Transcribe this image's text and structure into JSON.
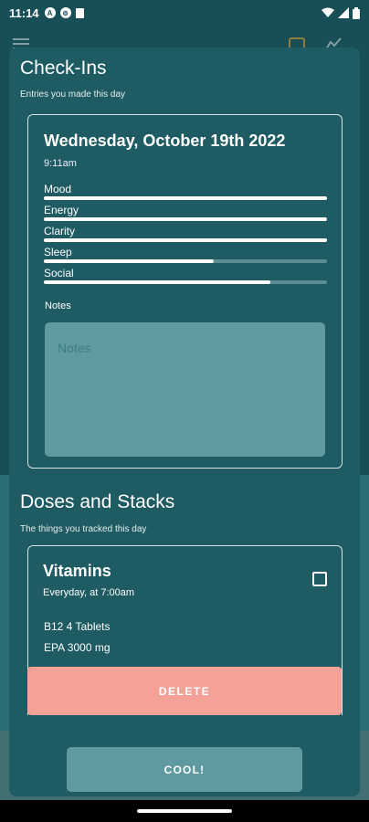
{
  "status_bar": {
    "time": "11:14",
    "icons": [
      "notification-a-icon",
      "vpn-icon",
      "sd-card-icon",
      "wifi-icon",
      "signal-icon",
      "battery-icon"
    ]
  },
  "background_app": {
    "toolbar_icons": [
      "menu-icon",
      "calendar-icon",
      "chart-icon"
    ]
  },
  "checkins": {
    "title": "Check-Ins",
    "subtitle": "Entries you made this day",
    "entry": {
      "date": "Wednesday, October 19th 2022",
      "time": "9:11am",
      "metrics": [
        {
          "label": "Mood",
          "value": 1.0
        },
        {
          "label": "Energy",
          "value": 1.0
        },
        {
          "label": "Clarity",
          "value": 1.0
        },
        {
          "label": "Sleep",
          "value": 0.6
        },
        {
          "label": "Social",
          "value": 0.8
        }
      ],
      "notes_label": "Notes",
      "notes_placeholder": "Notes"
    }
  },
  "doses": {
    "title": "Doses and Stacks",
    "subtitle": "The things you tracked this day",
    "stack": {
      "name": "Vitamins",
      "schedule": "Everyday, at 7:00am",
      "items": [
        "B12 4 Tablets",
        "EPA 3000 mg"
      ],
      "checked": false
    },
    "delete_label": "DELETE"
  },
  "confirm_label": "COOL!",
  "colors": {
    "sheet": "#1e5b62",
    "accent_delete": "#f4a298",
    "button": "#5e9aa0"
  }
}
